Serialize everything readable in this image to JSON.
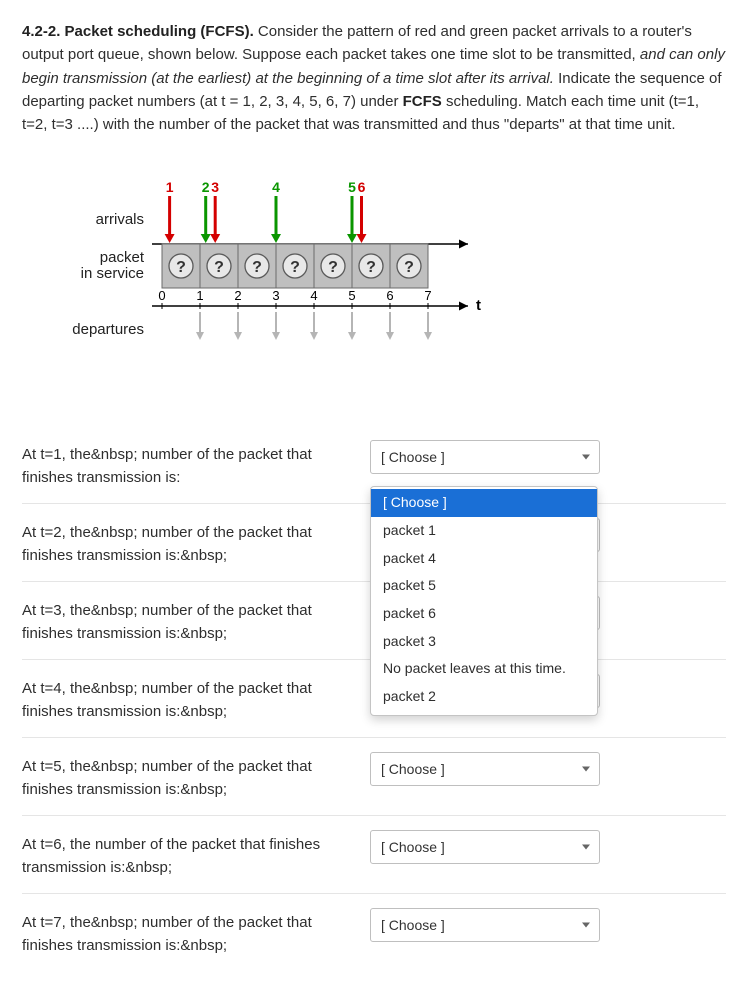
{
  "problem": {
    "number": "4.2-2.",
    "title_bold": "Packet scheduling (FCFS).",
    "body_part1": "Consider the pattern of red and green packet arrivals to a router's output port queue, shown below. Suppose each packet takes one time slot to be transmitted, ",
    "body_ital": "and can only begin transmission (at the earliest) at the beginning of a time slot after its arrival.",
    "body_part2": "  Indicate the sequence of departing packet numbers (at t = 1, 2, 3, 4, 5, 6, 7) under ",
    "body_bold2": "FCFS",
    "body_part3": " scheduling. Match each time unit (t=1, t=2, t=3 ....) with the number of the packet that was transmitted and thus \"departs\" at that time unit."
  },
  "figure": {
    "label_arrivals": "arrivals",
    "label_service": "packet\nin service",
    "label_departures": "departures",
    "axis_label": "t",
    "ticks": [
      "0",
      "1",
      "2",
      "3",
      "4",
      "5",
      "6",
      "7"
    ],
    "arrivals": [
      {
        "num": "1",
        "slot": 0,
        "offset": 0.2,
        "color": "#d40000"
      },
      {
        "num": "2",
        "slot": 1,
        "offset": 0.15,
        "color": "#0a9600"
      },
      {
        "num": "3",
        "slot": 1,
        "offset": 0.4,
        "color": "#d40000"
      },
      {
        "num": "4",
        "slot": 3,
        "offset": 0.0,
        "color": "#0a9600"
      },
      {
        "num": "5",
        "slot": 5,
        "offset": 0.0,
        "color": "#0a9600"
      },
      {
        "num": "6",
        "slot": 5,
        "offset": 0.25,
        "color": "#d40000"
      }
    ],
    "service_slots": 7,
    "q_mark": "?"
  },
  "dropdown": {
    "placeholder": "[ Choose ]",
    "options": [
      "[ Choose ]",
      "packet 1",
      "packet 4",
      "packet 5",
      "packet 6",
      "packet 3",
      "No packet leaves at this time.",
      "packet 2"
    ]
  },
  "questions": [
    {
      "label": "At t=1, the&nbsp; number of the packet that finishes transmission is:",
      "open": true
    },
    {
      "label": "At t=2, the&nbsp; number of the packet that finishes transmission is:&nbsp;",
      "open": false
    },
    {
      "label": "At t=3, the&nbsp; number of the packet that finishes transmission is:&nbsp;",
      "open": false
    },
    {
      "label": "At t=4, the&nbsp; number of the packet that finishes transmission is:&nbsp;",
      "open": false
    },
    {
      "label": "At t=5, the&nbsp; number of the packet that finishes transmission is:&nbsp;",
      "open": false
    },
    {
      "label": "At t=6, the number of the packet that finishes transmission is:&nbsp;",
      "open": false
    },
    {
      "label": "At t=7, the&nbsp; number of the packet that finishes transmission is:&nbsp;",
      "open": false
    }
  ]
}
